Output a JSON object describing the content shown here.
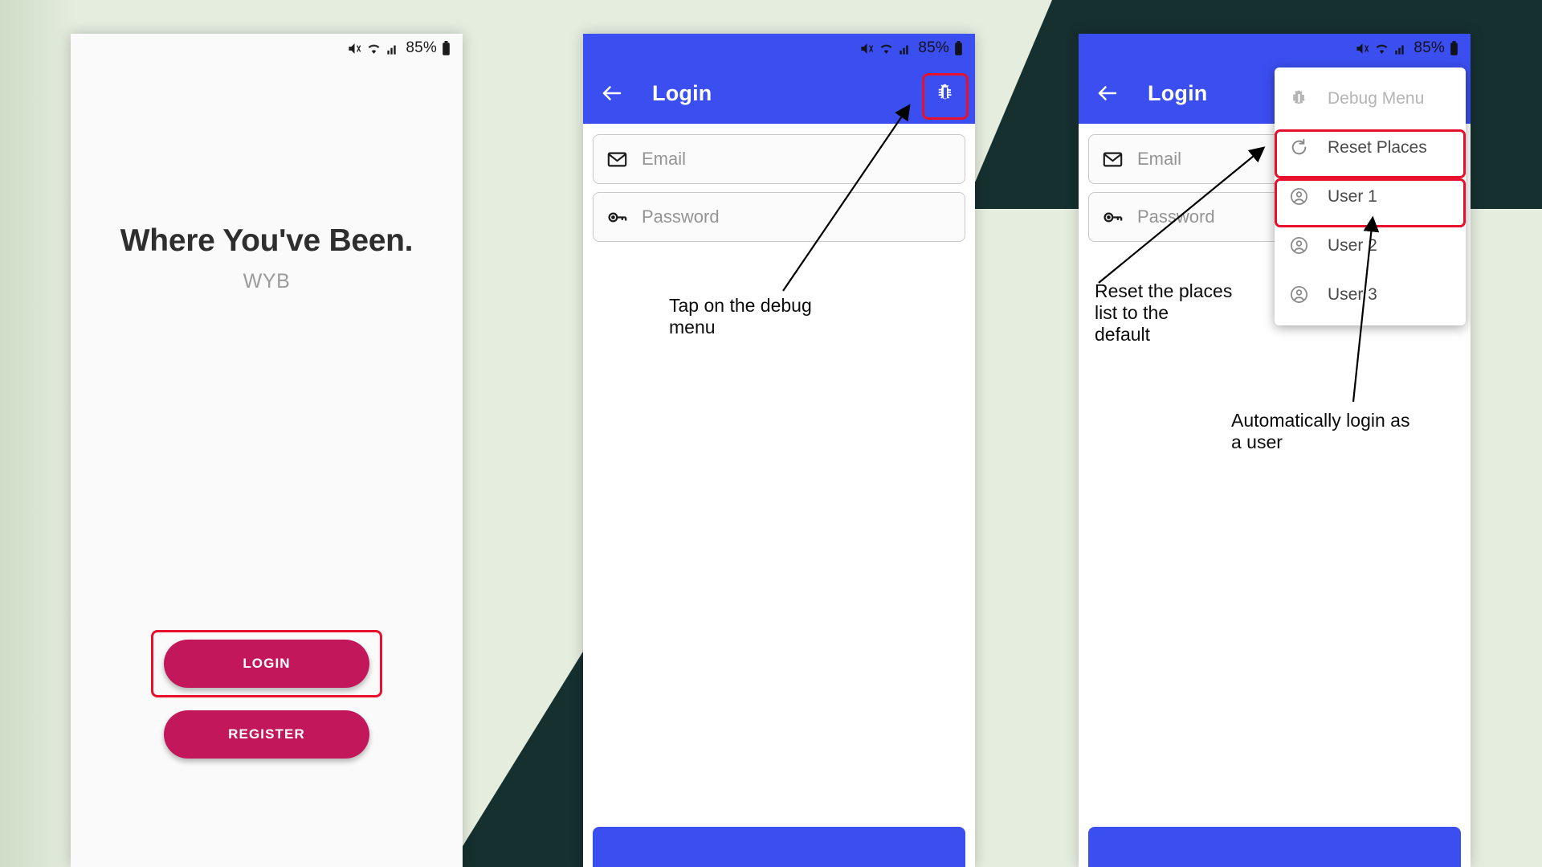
{
  "colors": {
    "background": "#e5eddf",
    "dark_shape": "#16302f",
    "app_bar_blue": "#3b4ef0",
    "brand_pink": "#c2185b",
    "highlight_red": "#e8112d"
  },
  "status_bar": {
    "battery_text": "85%",
    "icons": [
      "mute-icon",
      "wifi-icon",
      "signal-bars-icon",
      "battery-icon"
    ]
  },
  "phone1": {
    "title": "Where You've Been.",
    "subtitle": "WYB",
    "login_button": "LOGIN",
    "register_button": "REGISTER"
  },
  "phone2": {
    "appbar_title": "Login",
    "back_icon": "arrow-left-icon",
    "debug_icon": "bug-icon",
    "fields": [
      {
        "icon": "envelope-icon",
        "placeholder": "Email"
      },
      {
        "icon": "key-icon",
        "placeholder": "Password"
      }
    ]
  },
  "phone3": {
    "appbar_title": "Login",
    "back_icon": "arrow-left-icon",
    "fields": [
      {
        "icon": "envelope-icon",
        "placeholder": "Email"
      },
      {
        "icon": "key-icon",
        "placeholder": "Password"
      }
    ],
    "menu": {
      "items": [
        {
          "label": "Debug Menu",
          "icon": "bug-icon",
          "disabled": true
        },
        {
          "label": "Reset Places",
          "icon": "refresh-icon",
          "disabled": false
        },
        {
          "label": "User 1",
          "icon": "account-circle-icon",
          "disabled": false
        },
        {
          "label": "User 2",
          "icon": "account-circle-icon",
          "disabled": false
        },
        {
          "label": "User 3",
          "icon": "account-circle-icon",
          "disabled": false
        }
      ]
    }
  },
  "annotations": {
    "debug_menu": "Tap on the debug\nmenu",
    "reset_places": "Reset the places\nlist to the\ndefault",
    "auto_login": "Automatically login as\na user"
  }
}
